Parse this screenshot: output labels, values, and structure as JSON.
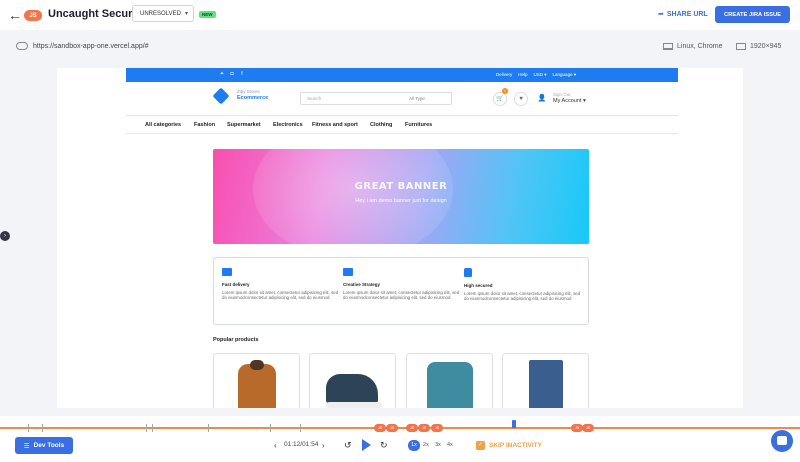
{
  "header": {
    "back_icon": "arrow-left-icon",
    "issue_badge": "JS",
    "title": "Uncaught Security",
    "status": "UNRESOLVED",
    "new_badge": "NEW",
    "share_label": "SHARE URL",
    "jira_label": "CREATE JIRA ISSUE"
  },
  "session": {
    "url": "https://sandbox-app-one.vercel.app/#",
    "environment": "Linux, Chrome",
    "resolution": "1920×945"
  },
  "site": {
    "topbar": {
      "menu": [
        "Delivery",
        "Help",
        "USD ▾",
        "Language ▾"
      ]
    },
    "logo": {
      "line1": "Zipy Stores",
      "line2": "Ecommerce"
    },
    "search_placeholder": "Search",
    "search_category": "All Type",
    "cart_count": "1",
    "account": {
      "greeting": "Sign Out",
      "label": "My Account ▾"
    },
    "categories": [
      "All categories",
      "Fashion",
      "Supermarket",
      "Electronics",
      "Fitness and sport",
      "Clothing",
      "Furnitures"
    ],
    "banner": {
      "title": "GREAT BANNER",
      "subtitle": "Hey i am demo banner just for design"
    },
    "features": [
      {
        "title": "Fast delivery",
        "text": "Lorem ipsum dolor sit amet, consectetur adipisicing elit, sed do eiusmodconsectetur adipisicing elit, sed do eiusmod"
      },
      {
        "title": "Creative Strategy",
        "text": "Lorem ipsum dolor sit amet, consectetur adipisicing elit, sed do eiusmodconsectetur adipisicing elit, sed do eiusmod"
      },
      {
        "title": "High secured",
        "text": "Lorem ipsum dolor sit amet, consectetur adipisicing elit, sed do eiusmodconsectetur adipisicing elit, sed do eiusmod"
      }
    ],
    "popular_title": "Popular products"
  },
  "player": {
    "devtools_label": "Dev Tools",
    "time": "01:12/01:54",
    "speeds": [
      "1x",
      "2x",
      "3x",
      "4x"
    ],
    "active_speed": "1x",
    "skip_label": "SKIP INACTIVITY",
    "markers": [
      "JS",
      "JS",
      "JS",
      "JS",
      "JS",
      "JS",
      "JS"
    ]
  },
  "colors": {
    "accent": "#3a6fe3",
    "error": "#f3734a",
    "site_blue": "#1f7cf0",
    "skip": "#f0a046"
  }
}
